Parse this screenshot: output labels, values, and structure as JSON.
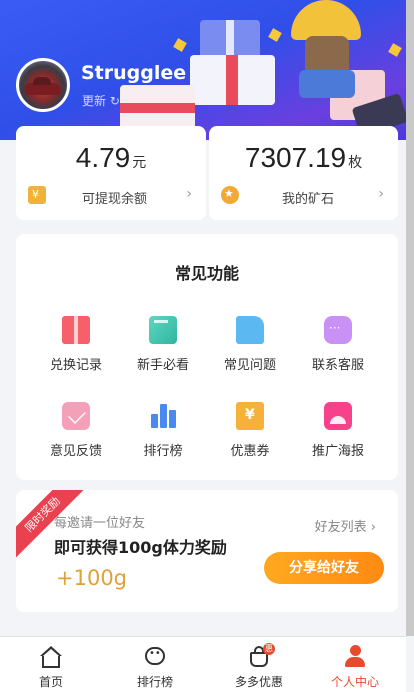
{
  "profile": {
    "username": "Strugglee",
    "update_label": "更新 ↻"
  },
  "balances": [
    {
      "amount": "4.79",
      "unit": "元",
      "label": "可提现余额",
      "icon": "yuan-wallet-icon"
    },
    {
      "amount": "7307.19",
      "unit": "枚",
      "label": "我的矿石",
      "icon": "star-coin-icon"
    }
  ],
  "features": {
    "title": "常见功能",
    "items": [
      {
        "label": "兑换记录",
        "icon": "gift-icon"
      },
      {
        "label": "新手必看",
        "icon": "book-icon"
      },
      {
        "label": "常见问题",
        "icon": "document-icon"
      },
      {
        "label": "联系客服",
        "icon": "chat-icon"
      },
      {
        "label": "意见反馈",
        "icon": "mail-icon"
      },
      {
        "label": "排行榜",
        "icon": "bar-chart-icon"
      },
      {
        "label": "优惠券",
        "icon": "coupon-icon"
      },
      {
        "label": "推广海报",
        "icon": "poster-icon"
      }
    ]
  },
  "invite": {
    "ribbon": "限时奖励",
    "subtitle": "每邀请一位好友",
    "title": "即可获得100g体力奖励",
    "bonus": "+100g",
    "friends_link": "好友列表",
    "share_button": "分享给好友"
  },
  "tabbar": {
    "items": [
      {
        "label": "首页",
        "icon": "home-icon",
        "active": false
      },
      {
        "label": "排行榜",
        "icon": "rank-icon",
        "active": false
      },
      {
        "label": "多多优惠",
        "icon": "shopping-bag-icon",
        "active": false,
        "badge": "惠"
      },
      {
        "label": "个人中心",
        "icon": "user-icon",
        "active": true
      }
    ]
  },
  "colors": {
    "header_bg": "#3b5df5",
    "accent_orange": "#ff9a1a",
    "active_tab": "#e84a2e",
    "bonus_text": "#e0a13a"
  }
}
